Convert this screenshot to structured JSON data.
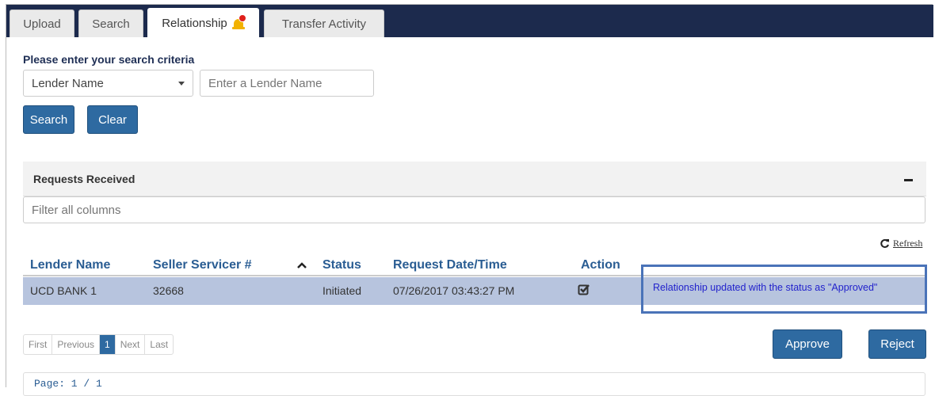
{
  "tabs": [
    {
      "label": "Upload"
    },
    {
      "label": "Search"
    },
    {
      "label": "Relationship"
    },
    {
      "label": "Transfer Activity"
    }
  ],
  "search": {
    "heading": "Please enter your search criteria",
    "select_value": "Lender Name",
    "input_placeholder": "Enter a Lender Name",
    "search_label": "Search",
    "clear_label": "Clear"
  },
  "panel": {
    "title": "Requests Received",
    "filter_placeholder": "Filter all columns",
    "refresh_label": "Refresh"
  },
  "table": {
    "columns": [
      "Lender Name",
      "Seller Servicer #",
      "Status",
      "Request Date/Time",
      "Action"
    ],
    "rows": [
      {
        "lender_name": "UCD BANK 1",
        "seller_servicer": "32668",
        "status": "Initiated",
        "request_datetime": "07/26/2017 03:43:27 PM"
      }
    ]
  },
  "message": "Relationship updated with the status as \"Approved\"",
  "pagination": {
    "first": "First",
    "previous": "Previous",
    "current": "1",
    "next": "Next",
    "last": "Last",
    "page_text": "Page: 1 / 1"
  },
  "actions": {
    "approve_label": "Approve",
    "reject_label": "Reject"
  },
  "colors": {
    "topbar": "#1c2a4d",
    "primary_button": "#2e6aa1",
    "selected_row": "#b7c4de",
    "header_text": "#2a5d93",
    "notification": "#f2b200"
  }
}
